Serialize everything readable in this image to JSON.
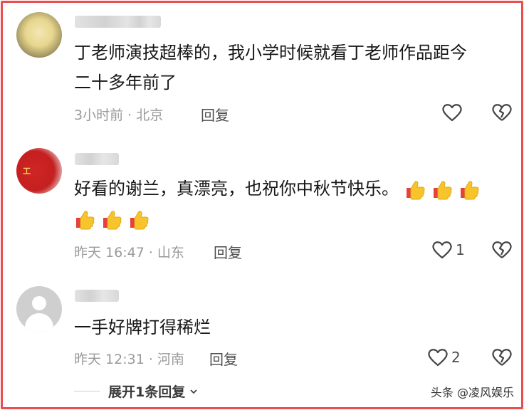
{
  "comments": [
    {
      "text_line1": "丁老师演技超棒的，我小学时候就看丁老师作品距今",
      "text_line2": "二十多年前了",
      "meta": "3小时前 · 北京",
      "reply_label": "回复",
      "like_count": "",
      "avatar_icon": "avatar-blurred-photo-icon"
    },
    {
      "text_line1": "好看的谢兰，真漂亮，也祝你中秋节快乐。",
      "emoji_icon": "thumbs-up-emoji-icon",
      "emoji_count": 6,
      "meta": "昨天 16:47 · 山东",
      "reply_label": "回复",
      "like_count": "1",
      "avatar_mark": "工",
      "avatar_icon": "avatar-blurred-red-icon"
    },
    {
      "text_line1": "一手好牌打得稀烂",
      "meta": "昨天 12:31 · 河南",
      "reply_label": "回复",
      "like_count": "2",
      "avatar_icon": "default-avatar-icon"
    }
  ],
  "expand_replies": {
    "label": "展开1条回复"
  },
  "watermark": "头条 @凌风娱乐",
  "colors": {
    "frame_border": "#e94d4d",
    "meta_text": "#9a9a9a",
    "thumb_yellow": "#f7c52b",
    "thumb_red": "#e8403a"
  }
}
